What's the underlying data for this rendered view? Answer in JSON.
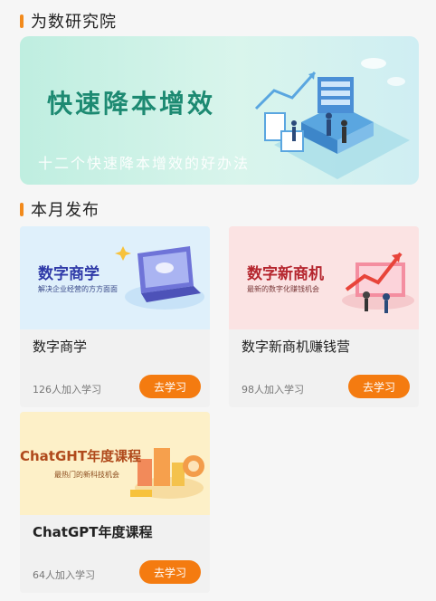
{
  "colors": {
    "accent": "#f28a1c",
    "button": "#f47b10",
    "banner_text": "#1d8a72"
  },
  "sections": {
    "research": {
      "title": "为数研究院"
    },
    "monthly": {
      "title": "本月发布"
    }
  },
  "banner": {
    "headline": "快速降本增效",
    "subtitle": "十二个快速降本增效的好办法"
  },
  "courses": [
    {
      "thumb_title": "数字商学",
      "thumb_sub": "解决企业经营的方方面面",
      "name": "数字商学",
      "count": "126人加入学习",
      "button": "去学习"
    },
    {
      "thumb_title": "数字新商机",
      "thumb_sub": "最新的数字化赚钱机会",
      "name": "数字新商机赚钱营",
      "count": "98人加入学习",
      "button": "去学习"
    },
    {
      "thumb_title": "ChatGHT年度课程",
      "thumb_sub": "最热门的新科技机会",
      "name": "ChatGPT年度课程",
      "count": "64人加入学习",
      "button": "去学习"
    }
  ]
}
